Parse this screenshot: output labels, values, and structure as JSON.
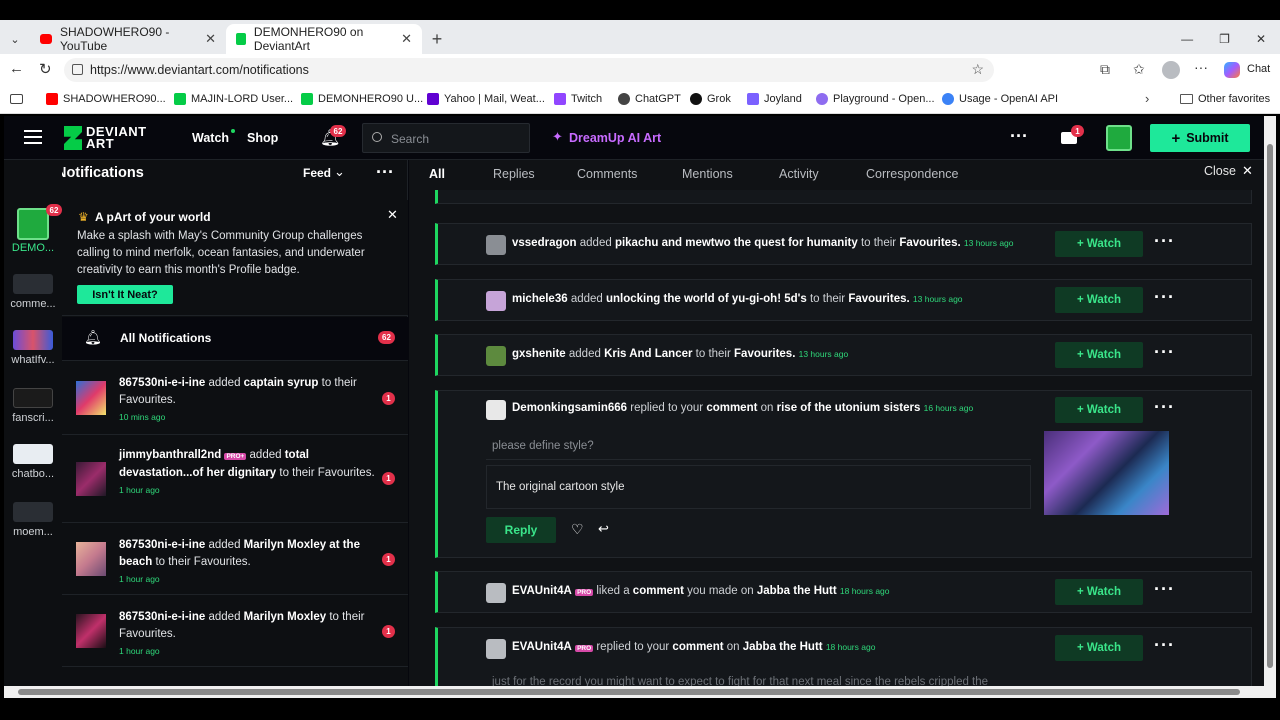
{
  "browser": {
    "tabs": [
      {
        "label": "SHADOWHERO90 - YouTube",
        "color": "#ff0000"
      },
      {
        "label": "DEMONHERO90 on DeviantArt",
        "color": "#05cc47"
      }
    ],
    "url": "https://www.deviantart.com/notifications",
    "chat_label": "Chat",
    "bookmarks": [
      {
        "label": "SHADOWHERO90...",
        "color": "#ff0000"
      },
      {
        "label": "MAJIN-LORD User...",
        "color": "#05cc47"
      },
      {
        "label": "DEMONHERO90 U...",
        "color": "#05cc47"
      },
      {
        "label": "Yahoo | Mail, Weat...",
        "color": "#6001d2"
      },
      {
        "label": "Twitch",
        "color": "#9146ff"
      },
      {
        "label": "ChatGPT",
        "color": "#444444"
      },
      {
        "label": "Grok",
        "color": "#111111"
      },
      {
        "label": "Joyland",
        "color": "#7b61ff"
      },
      {
        "label": "Playground - Open...",
        "color": "#8e6cf0"
      },
      {
        "label": "Usage - OpenAI API",
        "color": "#3b82f6"
      }
    ],
    "other_favorites": "Other favorites"
  },
  "header": {
    "logo_line1": "DEVIANT",
    "logo_line2": "ART",
    "watch": "Watch",
    "shop": "Shop",
    "bell_count": "62",
    "search_placeholder": "Search",
    "dreamup": "DreamUp AI Art",
    "mail_count": "1",
    "submit": "Submit"
  },
  "left": {
    "title": "Your Notifications",
    "feed": "Feed",
    "promo": {
      "title": "A pArt of your world",
      "body": "Make a splash with May's Community Group challenges calling to mind merfolk, ocean fantasies, and underwater creativity to earn this month's Profile badge.",
      "button": "Isn't It Neat?"
    },
    "all_label": "All Notifications",
    "all_count": "62",
    "rail": [
      {
        "label": "DEMO...",
        "badge": "62"
      },
      {
        "label": "comme..."
      },
      {
        "label": "whatIfv..."
      },
      {
        "label": "fanscri..."
      },
      {
        "label": "chatbo..."
      },
      {
        "label": "moem..."
      }
    ],
    "items": [
      {
        "user": "867530ni-e-i-ine",
        "pre": " added ",
        "item": "captain syrup",
        "post": " to their Favourites.",
        "time": "10 mins ago",
        "count": "1"
      },
      {
        "user": "jimmybanthrall2nd",
        "pre": " added ",
        "item": "total devastation...of her dignitary",
        "post": " to their Favourites.",
        "time": "1 hour ago",
        "count": "1"
      },
      {
        "user": "867530ni-e-i-ine",
        "pre": " added ",
        "item": "Marilyn Moxley at the beach",
        "post": " to their Favourites.",
        "time": "1 hour ago",
        "count": "1"
      },
      {
        "user": "867530ni-e-i-ine",
        "pre": " added ",
        "item": "Marilyn Moxley",
        "post": " to their Favourites.",
        "time": "1 hour ago",
        "count": "1"
      }
    ]
  },
  "main": {
    "tabs": [
      "All",
      "Replies",
      "Comments",
      "Mentions",
      "Activity",
      "Correspondence"
    ],
    "close": "Close",
    "watch_label": "+ Watch",
    "cards": [
      {
        "user": "vssedragon",
        "pre": " added ",
        "item": "pikachu and mewtwo the quest for humanity",
        "mid": " to their ",
        "target": "Favourites.",
        "time": "13 hours ago"
      },
      {
        "user": "michele36",
        "pre": " added ",
        "item": "unlocking the world of yu-gi-oh! 5d's",
        "mid": " to their ",
        "target": "Favourites.",
        "time": "13 hours ago"
      },
      {
        "user": "gxshenite",
        "pre": " added ",
        "item": "Kris And Lancer",
        "mid": " to their ",
        "target": "Favourites.",
        "time": "13 hours ago"
      }
    ],
    "reply_card": {
      "user": "Demonkingsamin666",
      "pre": " replied to your ",
      "item": "comment",
      "mid": " on ",
      "target": "rise of the utonium sisters",
      "time": "16 hours ago",
      "quote": "please define style?",
      "reply_text": "The original cartoon style",
      "reply_btn": "Reply"
    },
    "like_card": {
      "user": "EVAUnit4A",
      "pro": "PRO",
      "pre": " liked a ",
      "item": "comment",
      "mid": " you made on ",
      "target": "Jabba the Hutt",
      "time": "18 hours ago"
    },
    "reply_card2": {
      "user": "EVAUnit4A",
      "pro": "PRO",
      "pre": " replied to your ",
      "item": "comment",
      "mid": " on ",
      "target": "Jabba the Hutt",
      "time": "18 hours ago",
      "preview": "just for the record you might want to expect to fight for that next meal since the rebels crippled the"
    }
  }
}
